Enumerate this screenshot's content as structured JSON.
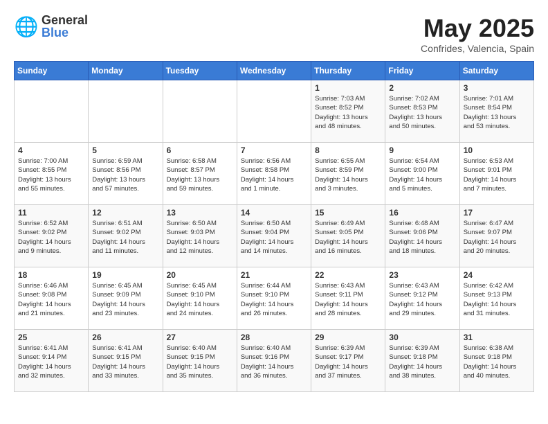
{
  "header": {
    "logo_general": "General",
    "logo_blue": "Blue",
    "month": "May 2025",
    "location": "Confrides, Valencia, Spain"
  },
  "days_of_week": [
    "Sunday",
    "Monday",
    "Tuesday",
    "Wednesday",
    "Thursday",
    "Friday",
    "Saturday"
  ],
  "weeks": [
    [
      {
        "day": "",
        "info": ""
      },
      {
        "day": "",
        "info": ""
      },
      {
        "day": "",
        "info": ""
      },
      {
        "day": "",
        "info": ""
      },
      {
        "day": "1",
        "info": "Sunrise: 7:03 AM\nSunset: 8:52 PM\nDaylight: 13 hours\nand 48 minutes."
      },
      {
        "day": "2",
        "info": "Sunrise: 7:02 AM\nSunset: 8:53 PM\nDaylight: 13 hours\nand 50 minutes."
      },
      {
        "day": "3",
        "info": "Sunrise: 7:01 AM\nSunset: 8:54 PM\nDaylight: 13 hours\nand 53 minutes."
      }
    ],
    [
      {
        "day": "4",
        "info": "Sunrise: 7:00 AM\nSunset: 8:55 PM\nDaylight: 13 hours\nand 55 minutes."
      },
      {
        "day": "5",
        "info": "Sunrise: 6:59 AM\nSunset: 8:56 PM\nDaylight: 13 hours\nand 57 minutes."
      },
      {
        "day": "6",
        "info": "Sunrise: 6:58 AM\nSunset: 8:57 PM\nDaylight: 13 hours\nand 59 minutes."
      },
      {
        "day": "7",
        "info": "Sunrise: 6:56 AM\nSunset: 8:58 PM\nDaylight: 14 hours\nand 1 minute."
      },
      {
        "day": "8",
        "info": "Sunrise: 6:55 AM\nSunset: 8:59 PM\nDaylight: 14 hours\nand 3 minutes."
      },
      {
        "day": "9",
        "info": "Sunrise: 6:54 AM\nSunset: 9:00 PM\nDaylight: 14 hours\nand 5 minutes."
      },
      {
        "day": "10",
        "info": "Sunrise: 6:53 AM\nSunset: 9:01 PM\nDaylight: 14 hours\nand 7 minutes."
      }
    ],
    [
      {
        "day": "11",
        "info": "Sunrise: 6:52 AM\nSunset: 9:02 PM\nDaylight: 14 hours\nand 9 minutes."
      },
      {
        "day": "12",
        "info": "Sunrise: 6:51 AM\nSunset: 9:02 PM\nDaylight: 14 hours\nand 11 minutes."
      },
      {
        "day": "13",
        "info": "Sunrise: 6:50 AM\nSunset: 9:03 PM\nDaylight: 14 hours\nand 12 minutes."
      },
      {
        "day": "14",
        "info": "Sunrise: 6:50 AM\nSunset: 9:04 PM\nDaylight: 14 hours\nand 14 minutes."
      },
      {
        "day": "15",
        "info": "Sunrise: 6:49 AM\nSunset: 9:05 PM\nDaylight: 14 hours\nand 16 minutes."
      },
      {
        "day": "16",
        "info": "Sunrise: 6:48 AM\nSunset: 9:06 PM\nDaylight: 14 hours\nand 18 minutes."
      },
      {
        "day": "17",
        "info": "Sunrise: 6:47 AM\nSunset: 9:07 PM\nDaylight: 14 hours\nand 20 minutes."
      }
    ],
    [
      {
        "day": "18",
        "info": "Sunrise: 6:46 AM\nSunset: 9:08 PM\nDaylight: 14 hours\nand 21 minutes."
      },
      {
        "day": "19",
        "info": "Sunrise: 6:45 AM\nSunset: 9:09 PM\nDaylight: 14 hours\nand 23 minutes."
      },
      {
        "day": "20",
        "info": "Sunrise: 6:45 AM\nSunset: 9:10 PM\nDaylight: 14 hours\nand 24 minutes."
      },
      {
        "day": "21",
        "info": "Sunrise: 6:44 AM\nSunset: 9:10 PM\nDaylight: 14 hours\nand 26 minutes."
      },
      {
        "day": "22",
        "info": "Sunrise: 6:43 AM\nSunset: 9:11 PM\nDaylight: 14 hours\nand 28 minutes."
      },
      {
        "day": "23",
        "info": "Sunrise: 6:43 AM\nSunset: 9:12 PM\nDaylight: 14 hours\nand 29 minutes."
      },
      {
        "day": "24",
        "info": "Sunrise: 6:42 AM\nSunset: 9:13 PM\nDaylight: 14 hours\nand 31 minutes."
      }
    ],
    [
      {
        "day": "25",
        "info": "Sunrise: 6:41 AM\nSunset: 9:14 PM\nDaylight: 14 hours\nand 32 minutes."
      },
      {
        "day": "26",
        "info": "Sunrise: 6:41 AM\nSunset: 9:15 PM\nDaylight: 14 hours\nand 33 minutes."
      },
      {
        "day": "27",
        "info": "Sunrise: 6:40 AM\nSunset: 9:15 PM\nDaylight: 14 hours\nand 35 minutes."
      },
      {
        "day": "28",
        "info": "Sunrise: 6:40 AM\nSunset: 9:16 PM\nDaylight: 14 hours\nand 36 minutes."
      },
      {
        "day": "29",
        "info": "Sunrise: 6:39 AM\nSunset: 9:17 PM\nDaylight: 14 hours\nand 37 minutes."
      },
      {
        "day": "30",
        "info": "Sunrise: 6:39 AM\nSunset: 9:18 PM\nDaylight: 14 hours\nand 38 minutes."
      },
      {
        "day": "31",
        "info": "Sunrise: 6:38 AM\nSunset: 9:18 PM\nDaylight: 14 hours\nand 40 minutes."
      }
    ]
  ]
}
